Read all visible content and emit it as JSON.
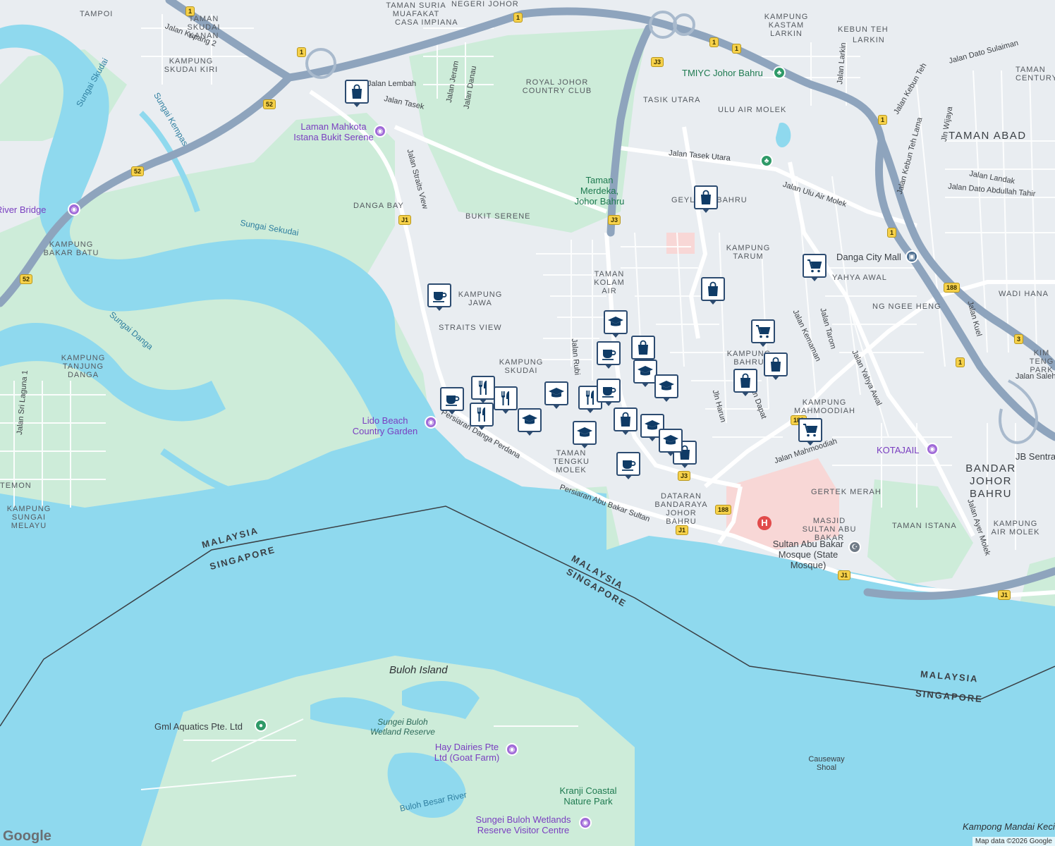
{
  "map": {
    "area_labels": [
      {
        "text": "TAMPOI",
        "kind": "area"
      },
      {
        "text": "TAMAN SKUDAI KANAN",
        "kind": "area"
      },
      {
        "text": "KAMPUNG SKUDAI KIRI",
        "kind": "area"
      },
      {
        "text": "TAMAN SURIA MUAFAKAT",
        "kind": "area"
      },
      {
        "text": "CASA IMPIANA",
        "kind": "area"
      },
      {
        "text": "NEGERI JOHOR",
        "kind": "area"
      },
      {
        "text": "ROYAL JOHOR COUNTRY CLUB",
        "kind": "area"
      },
      {
        "text": "TASIK UTARA",
        "kind": "area"
      },
      {
        "text": "ULU AIR MOLEK",
        "kind": "area"
      },
      {
        "text": "KAMPUNG KASTAM LARKIN",
        "kind": "area"
      },
      {
        "text": "KEBUN TEH",
        "kind": "area"
      },
      {
        "text": "LARKIN",
        "kind": "area"
      },
      {
        "text": "TAMAN CENTURY",
        "kind": "area"
      },
      {
        "text": "TAMAN ABAD",
        "kind": "bigarea"
      },
      {
        "text": "DANGA BAY",
        "kind": "area"
      },
      {
        "text": "BUKIT SERENE",
        "kind": "area"
      },
      {
        "text": "KAMPUNG BAKAR BATU",
        "kind": "area"
      },
      {
        "text": "KAMPUNG JAWA",
        "kind": "area"
      },
      {
        "text": "STRAITS VIEW",
        "kind": "area"
      },
      {
        "text": "TAMAN KOLAM AIR",
        "kind": "area"
      },
      {
        "text": "GEYLANG BAHRU",
        "kind": "area"
      },
      {
        "text": "KAMPUNG TARUM",
        "kind": "area"
      },
      {
        "text": "YAHYA AWAL",
        "kind": "area"
      },
      {
        "text": "WADI HANA",
        "kind": "area"
      },
      {
        "text": "NG NGEE HENG",
        "kind": "area"
      },
      {
        "text": "KIM TENG PARK",
        "kind": "area"
      },
      {
        "text": "KAMPUNG SKUDAI",
        "kind": "area"
      },
      {
        "text": "KAMPUNG BAHRU",
        "kind": "area"
      },
      {
        "text": "KAMPUNG MAHMOODIAH",
        "kind": "area"
      },
      {
        "text": "KAMPUNG TANJUNG DANGA",
        "kind": "area"
      },
      {
        "text": "TAMAN TENGKU MOLEK",
        "kind": "area"
      },
      {
        "text": "DATARAN BANDARAYA JOHOR BAHRU",
        "kind": "area"
      },
      {
        "text": "GERTEK MERAH",
        "kind": "area"
      },
      {
        "text": "BANDAR JOHOR BAHRU",
        "kind": "bigarea"
      },
      {
        "text": "MASJID SULTAN ABU BAKAR",
        "kind": "area"
      },
      {
        "text": "TAMAN ISTANA",
        "kind": "area"
      },
      {
        "text": "KAMPUNG AIR MOLEK",
        "kind": "area"
      },
      {
        "text": "KAMPUNG SUNGAI MELAYU",
        "kind": "area"
      },
      {
        "text": "TEMON",
        "kind": "area"
      }
    ],
    "street_labels": [
      "Jalan Kupang 2",
      "Jalan Lembah",
      "Jalan Tasek",
      "Jalan Jeram",
      "Jalan Danau",
      "Jalan Straits View",
      "Jalan Tasek Utara",
      "Jalan Ulu Air Molek",
      "Jalan Yahya Awal",
      "Jalan Kebun Teh Lama",
      "Jalan Kebun Teh",
      "Jalan Dato Sulaiman",
      "Jalan Dato Abdullah Tahir",
      "Jalan Landak",
      "Jalan Larkin",
      "Jln Wijaya",
      "Jalan Kuel",
      "Jalan Kemaman",
      "Jalan Tarom",
      "Jalan Rubi",
      "Jln Harun",
      "Jalan Dapat",
      "Jalan Mahmoodiah",
      "Persiaran Danga Perdana",
      "Persiaran Abu Bakar Sultan",
      "Jalan Ayer Molek",
      "Jalan Sri Laguna 1",
      "Jalan Saleh"
    ],
    "water_labels": [
      "Sungai Skudai",
      "Sungai Kempas",
      "Sungai Sekudai",
      "Sungai Danga",
      "Buloh Besar River",
      "Sungei Buloh Wetland Reserve",
      "Causeway Shoal",
      "Kampong Mandai Kecil"
    ],
    "island_labels": [
      "Buloh Island"
    ],
    "border_labels": [
      "MALAYSIA",
      "SINGAPORE",
      "MALAYSIA",
      "SINGAPORE",
      "MALAYSIA",
      "SINGAPORE"
    ],
    "places": [
      {
        "text": "Laman Mahkota Istana Bukit Serene",
        "kind": "poi"
      },
      {
        "text": "Lido Beach Country Garden",
        "kind": "poi"
      },
      {
        "text": "Sultan Abu Bakar Mosque (State Mosque)",
        "kind": "poi-dark"
      },
      {
        "text": "KOTAJAIL",
        "kind": "poi"
      },
      {
        "text": "TMIYC Johor Bahru",
        "kind": "poi-green"
      },
      {
        "text": "Taman Merdeka, Johor Bahru",
        "kind": "poi-green"
      },
      {
        "text": "Danga City Mall",
        "kind": "poi-dark"
      },
      {
        "text": "Danga River Bridge",
        "kind": "poi"
      },
      {
        "text": "Gml Aquatics Pte. Ltd",
        "kind": "poi-dark"
      },
      {
        "text": "Hay Dairies Pte Ltd (Goat Farm)",
        "kind": "poi"
      },
      {
        "text": "Kranji Coastal Nature Park",
        "kind": "poi-green"
      },
      {
        "text": "Sungei Buloh Wetlands Reserve Visitor Centre",
        "kind": "poi"
      },
      {
        "text": "JB Sentral",
        "kind": "poi-dark"
      }
    ],
    "route_shields": [
      "1",
      "1",
      "1",
      "1",
      "1",
      "1",
      "1",
      "1",
      "52",
      "52",
      "52",
      "J3",
      "J3",
      "J3",
      "J1",
      "J1",
      "J1",
      "J1",
      "188",
      "188",
      "188",
      "3"
    ],
    "pins": [
      "shopping-bag-icon",
      "coffee-cup-icon",
      "shopping-bag-icon",
      "shopping-cart-icon",
      "shopping-bag-icon",
      "shopping-cart-icon",
      "shopping-bag-icon",
      "shopping-bag-icon",
      "shopping-cart-icon",
      "graduation-cap-icon",
      "coffee-cup-icon",
      "shopping-bag-icon",
      "restaurant-icon",
      "restaurant-icon",
      "restaurant-icon",
      "coffee-cup-icon",
      "graduation-cap-icon",
      "restaurant-icon",
      "graduation-cap-icon",
      "graduation-cap-icon",
      "coffee-cup-icon",
      "shopping-bag-icon",
      "graduation-cap-icon",
      "graduation-cap-icon",
      "shopping-bag-icon",
      "coffee-cup-icon",
      "graduation-cap-icon",
      "graduation-cap-icon"
    ],
    "colors": {
      "sea": "#8fd9ee",
      "land": "#e9edf1",
      "park": "#c8ecd6",
      "road": "#ffffff",
      "highway": "#8ea4bd",
      "pin_border": "#2c4b70",
      "pin_icon": "#0f3b66",
      "hospital": "#e14b4b"
    },
    "attribution": "Map data ©2026 Google",
    "logo": "Google"
  }
}
